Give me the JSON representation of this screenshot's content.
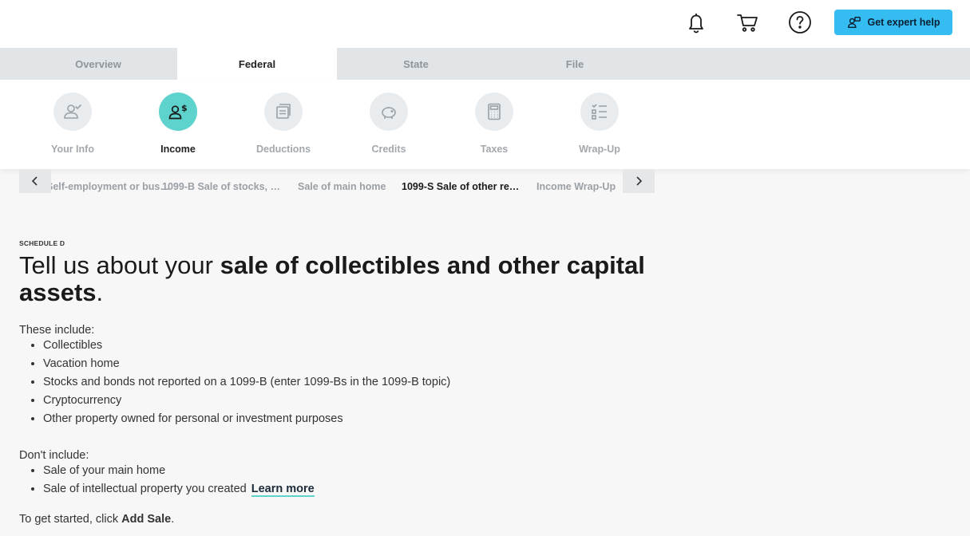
{
  "header": {
    "expert_label": "Get expert help",
    "icons": [
      "bell-icon",
      "cart-icon",
      "help-icon",
      "expert-icon"
    ]
  },
  "main_tabs": [
    {
      "label": "Overview",
      "active": false
    },
    {
      "label": "Federal",
      "active": true
    },
    {
      "label": "State",
      "active": false
    },
    {
      "label": "File",
      "active": false
    }
  ],
  "steps": [
    {
      "label": "Your Info",
      "icon": "person-check-icon",
      "active": false
    },
    {
      "label": "Income",
      "icon": "person-dollar-icon",
      "active": true
    },
    {
      "label": "Deductions",
      "icon": "receipt-icon",
      "active": false
    },
    {
      "label": "Credits",
      "icon": "piggy-bank-icon",
      "active": false
    },
    {
      "label": "Taxes",
      "icon": "calculator-icon",
      "active": false
    },
    {
      "label": "Wrap-Up",
      "icon": "checklist-icon",
      "active": false
    }
  ],
  "breadcrumbs": [
    {
      "label": "Self-employment or bus…",
      "active": false
    },
    {
      "label": "1099-B Sale of stocks, …",
      "active": false
    },
    {
      "label": "Sale of main home",
      "active": false
    },
    {
      "label": "1099-S Sale of other re…",
      "active": true
    },
    {
      "label": "Income Wrap-Up",
      "active": false
    }
  ],
  "content": {
    "eyebrow": "SCHEDULE D",
    "headline_prefix": "Tell us about your ",
    "headline_bold": "sale of collectibles and other capital assets",
    "headline_suffix": ".",
    "include_heading": "These include:",
    "include_items": [
      "Collectibles",
      "Vacation home",
      "Stocks and bonds not reported on a 1099-B (enter 1099-Bs in the 1099-B topic)",
      "Cryptocurrency",
      "Other property owned for personal or investment purposes"
    ],
    "exclude_heading": "Don't include:",
    "exclude_item_1": "Sale of your main home",
    "exclude_item_2": "Sale of intellectual property you created",
    "learn_more": "Learn more",
    "start_prefix": "To get started, click ",
    "start_bold": "Add Sale",
    "start_suffix": "."
  },
  "colors": {
    "accent_teal": "#5ed2cc",
    "expert_button": "#35bdf2",
    "tab_bar": "#e2e5e8"
  }
}
